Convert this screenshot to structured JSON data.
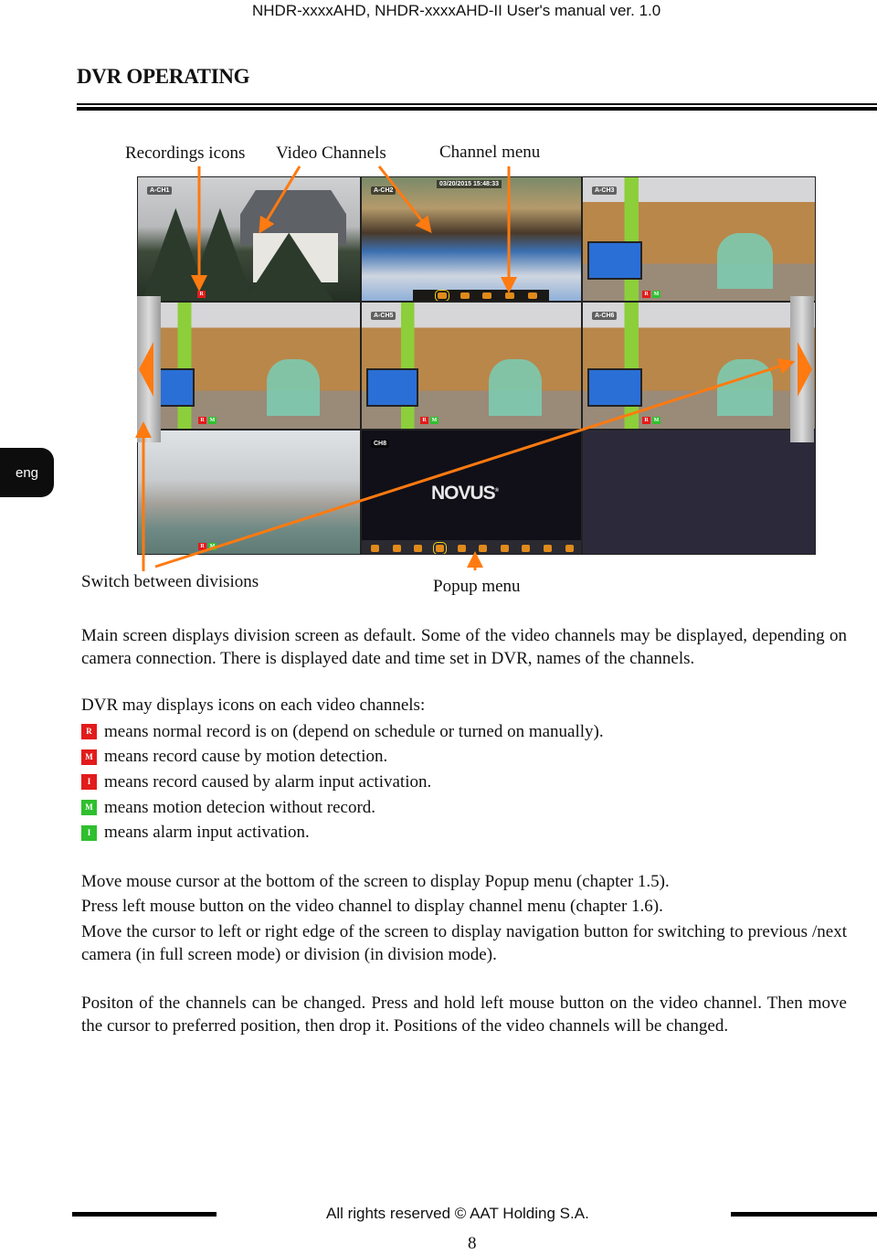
{
  "header": {
    "manual_title": "NHDR-xxxxAHD, NHDR-xxxxAHD-II User's manual ver. 1.0"
  },
  "section_title": "DVR OPERATING",
  "language_tab": "eng",
  "callouts": {
    "recordings_icons": "Recordings icons",
    "video_channels": "Video Channels",
    "channel_menu": "Channel menu",
    "switch_divisions": "Switch between divisions",
    "popup_menu": "Popup menu"
  },
  "dvr_screen": {
    "datetime": "03/20/2015 15:48:33",
    "channels": [
      {
        "label": "A-CH1",
        "badges": [
          "R"
        ]
      },
      {
        "label": "A-CH2",
        "badges": []
      },
      {
        "label": "A-CH3",
        "badges": [
          "R",
          "M"
        ]
      },
      {
        "label": "",
        "badges": [
          "R",
          "M"
        ]
      },
      {
        "label": "A-CH5",
        "badges": [
          "R",
          "M"
        ]
      },
      {
        "label": "A-CH6",
        "badges": [
          "R",
          "M"
        ]
      },
      {
        "label": "",
        "badges": [
          "R",
          "M"
        ]
      },
      {
        "label": "CH8",
        "badges": []
      }
    ],
    "logo": "NOVUS",
    "logo_mark": "®",
    "channel_menu_icons": [
      "record-icon",
      "snapshot-icon",
      "zoom-icon",
      "color-icon",
      "ptz-icon"
    ],
    "popup_menu_icons": [
      "single-view-icon",
      "quad-view-icon",
      "nine-view-icon",
      "main-menu-icon",
      "sequence-icon",
      "audio-icon",
      "ptz-icon",
      "record-icon",
      "snapshot-icon",
      "playback-icon"
    ]
  },
  "body": {
    "intro": "Main screen displays division screen as default. Some of the video channels may be displayed, depending on camera connection. There is displayed date and time set in DVR, names of the channels.",
    "icons_intro": "DVR may displays icons on each video channels:",
    "legend": [
      {
        "badge": "R",
        "color": "#e21b1b",
        "text": "means normal record is on (depend on schedule or turned on manually)."
      },
      {
        "badge": "M",
        "color": "#e21b1b",
        "text": "means record cause by motion detection."
      },
      {
        "badge": "I",
        "color": "#e21b1b",
        "text": "means record caused by alarm input activation."
      },
      {
        "badge": "M",
        "color": "#2fbf2f",
        "text": "means motion detecion without record."
      },
      {
        "badge": "I",
        "color": "#2fbf2f",
        "text": "means alarm input activation."
      }
    ],
    "popup_hint": "Move mouse cursor at the bottom of the screen to display Popup menu (chapter 1.5).",
    "channel_hint": "Press left mouse button on the video channel to display channel menu (chapter 1.6).",
    "nav_hint": "Move the cursor to left or right edge of the screen to display navigation button for switching to previous /next camera (in full screen mode) or division (in division mode).",
    "position_hint": "Positon of the channels can be changed. Press and hold left mouse button on the video channel. Then move the cursor to preferred position, then drop it. Positions of the video channels will be changed."
  },
  "footer": {
    "copyright": "All rights reserved © AAT Holding S.A.",
    "page_number": "8"
  },
  "colors": {
    "accent_orange": "#ff7a10",
    "record_red": "#e21b1b",
    "motion_green": "#2fbf2f"
  }
}
